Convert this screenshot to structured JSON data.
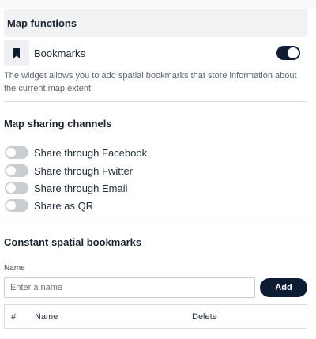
{
  "map_functions": {
    "title": "Map functions",
    "bookmarks": {
      "label": "Bookmarks",
      "icon": "bookmark-icon",
      "enabled": true,
      "description": "The widget allows you to add spatial bookmarks that store information about the current map extent"
    }
  },
  "sharing": {
    "title": "Map sharing channels",
    "channels": [
      {
        "label": "Share through Facebook",
        "enabled": false
      },
      {
        "label": "Share through Fwitter",
        "enabled": false
      },
      {
        "label": "Share through Email",
        "enabled": false
      },
      {
        "label": "Share as QR",
        "enabled": false
      }
    ]
  },
  "constant_bookmarks": {
    "title": "Constant spatial bookmarks",
    "name_label": "Name",
    "name_placeholder": "Enter a name",
    "add_label": "Add",
    "table_headers": [
      "#",
      "Name",
      "Delete"
    ]
  },
  "colors": {
    "accent": "#0d1b33",
    "toggle_off": "#c9ccd1",
    "header_bg": "#f1f2f4"
  }
}
